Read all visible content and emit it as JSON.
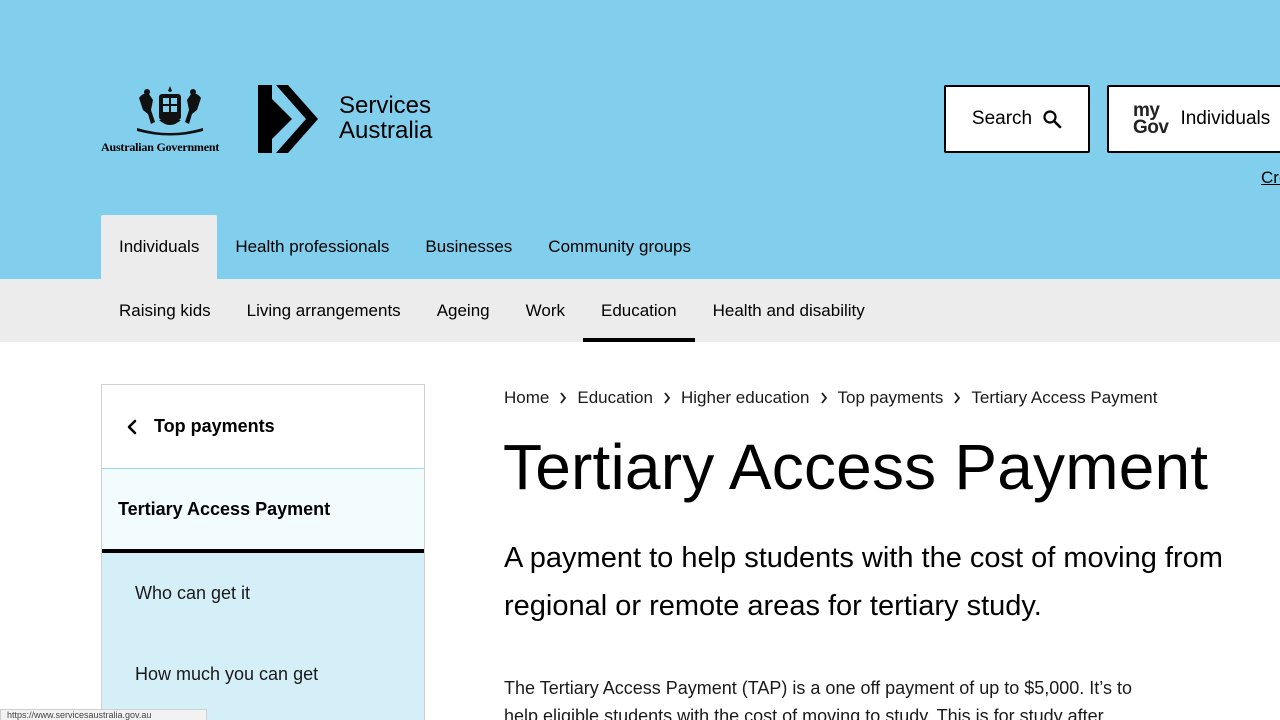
{
  "header": {
    "gov_logo_text": "Australian Government",
    "agency_line1": "Services",
    "agency_line2": "Australia",
    "search_label": "Search",
    "mygov_mark_line1": "my",
    "mygov_mark_line2": "Gov",
    "mygov_label": "Individuals",
    "create_link": "Cre"
  },
  "audience_tabs": [
    {
      "label": "Individuals",
      "active": true
    },
    {
      "label": "Health professionals"
    },
    {
      "label": "Businesses"
    },
    {
      "label": "Community groups"
    }
  ],
  "topic_nav": [
    {
      "label": "Raising kids"
    },
    {
      "label": "Living arrangements"
    },
    {
      "label": "Ageing"
    },
    {
      "label": "Work"
    },
    {
      "label": "Education",
      "active": true
    },
    {
      "label": "Health and disability"
    }
  ],
  "side_nav": {
    "back_label": "Top payments",
    "current_label": "Tertiary Access Payment",
    "items": [
      {
        "label": "Who can get it"
      },
      {
        "label": "How much you can get"
      }
    ]
  },
  "breadcrumb": [
    {
      "label": "Home"
    },
    {
      "label": "Education"
    },
    {
      "label": "Higher education"
    },
    {
      "label": "Top payments"
    },
    {
      "label": "Tertiary Access Payment"
    }
  ],
  "main": {
    "title": "Tertiary Access Payment",
    "lead": "A payment to help students with the cost of moving from regional or remote areas for tertiary study.",
    "body": "The Tertiary Access Payment (TAP) is a one off payment of up to $5,000. It’s to help eligible students with the cost of moving to study. This is for study after"
  },
  "status_bar": {
    "url": "https://www.servicesaustralia.gov.au"
  }
}
